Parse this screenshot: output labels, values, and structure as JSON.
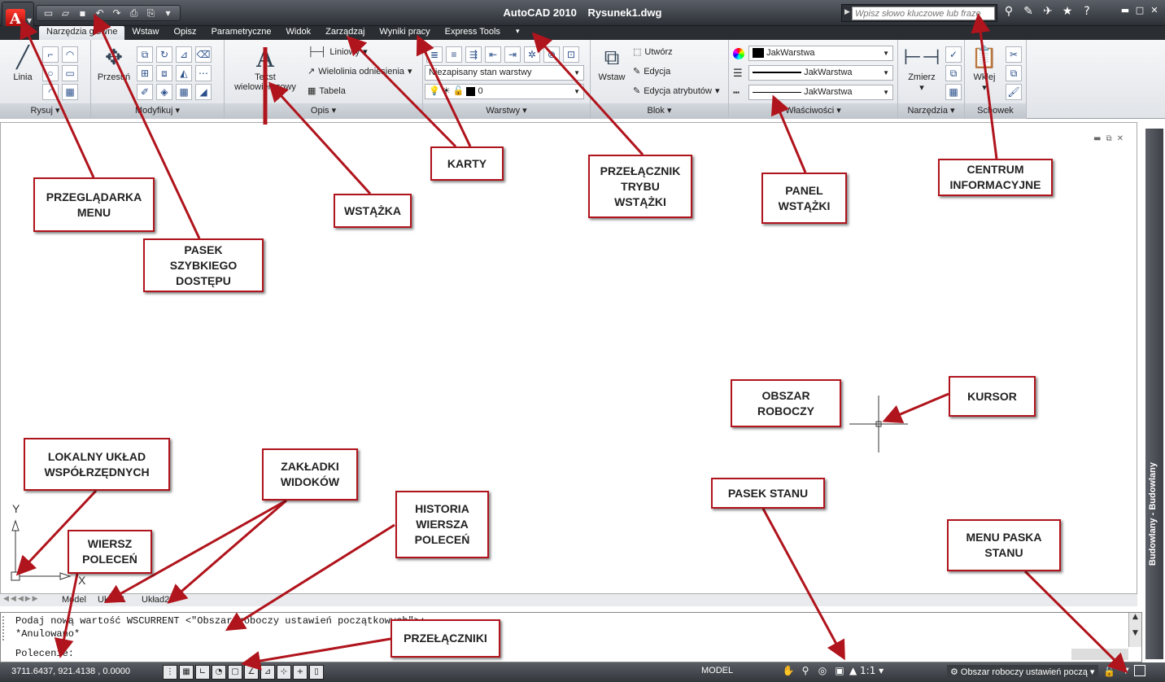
{
  "window": {
    "app_name": "AutoCAD 2010",
    "file_name": "Rysunek1.dwg"
  },
  "quick_access": [
    "new-icon",
    "open-icon",
    "save-icon",
    "undo-icon",
    "redo-icon",
    "plot-icon",
    "publish-icon"
  ],
  "infocenter": {
    "search_placeholder": "Wpisz słowo kluczowe lub frazę"
  },
  "tabs": [
    "Narzędzia główne",
    "Wstaw",
    "Opisz",
    "Parametryczne",
    "Widok",
    "Zarządzaj",
    "Wyniki pracy",
    "Express Tools"
  ],
  "ribbon": {
    "rysuj": {
      "title": "Rysuj",
      "linia": "Linia"
    },
    "modyfikuj": {
      "title": "Modyfikuj",
      "przesun": "Przesuń"
    },
    "opis": {
      "title": "Opis",
      "tekst": "Tekst",
      "tekst2": "wielowierszowy",
      "liniowy": "Liniowy",
      "wielolinia": "Wielolinia odniesienia",
      "tabela": "Tabela"
    },
    "warstwy": {
      "title": "Warstwy",
      "stan": "Niezapisany stan warstwy",
      "warstwa": "0"
    },
    "blok": {
      "title": "Blok",
      "wstaw": "Wstaw",
      "utworz": "Utwórz",
      "edycja": "Edycja",
      "edycja_atr": "Edycja atrybutów"
    },
    "wlasciwosci": {
      "title": "Właściwości",
      "kolor": "JakWarstwa",
      "rodzaj": "JakWarstwa",
      "grubosc": "JakWarstwa"
    },
    "narzedzia": {
      "title": "Narzędzia",
      "zmierz": "Zmierz"
    },
    "schowek": {
      "title": "Schowek",
      "wklej": "Wklej"
    }
  },
  "side_palette": "Budowlany - Budowlany",
  "layout_tabs": [
    "Model",
    "Układ1",
    "Układ2"
  ],
  "ucs": {
    "y": "Y",
    "x": "X"
  },
  "command_line": {
    "history": [
      "Podaj nową wartość WSCURRENT <\"Obszar roboczy ustawień początkowych\">:",
      "*Anulowano*"
    ],
    "prompt": "Polecenie:"
  },
  "status_bar": {
    "coordinates": "3711.6437, 921.4138 , 0.0000",
    "model": "MODEL",
    "scale": "1:1",
    "workspace": "Obszar roboczy ustawień począ"
  },
  "callouts": [
    {
      "id": "przegladarka",
      "text": "PRZEGLĄDARKA\nMENU"
    },
    {
      "id": "pasek-szybki",
      "text": "PASEK\nSZYBKIEGO\nDOSTĘPU"
    },
    {
      "id": "wstazka",
      "text": "WSTĄŻKA"
    },
    {
      "id": "karty",
      "text": "KARTY"
    },
    {
      "id": "przelacznik",
      "text": "PRZEŁĄCZNIK\nTRYBU\nWSTĄŻKI"
    },
    {
      "id": "panel",
      "text": "PANEL\nWSTĄŻKI"
    },
    {
      "id": "centrum",
      "text": "CENTRUM\nINFORMACYJNE"
    },
    {
      "id": "obszar",
      "text": "OBSZAR\nROBOCZY"
    },
    {
      "id": "kursor",
      "text": "KURSOR"
    },
    {
      "id": "lokalny",
      "text": "LOKALNY UKŁAD\nWSPÓŁRZĘDNYCH"
    },
    {
      "id": "zakladki",
      "text": "ZAKŁADKI\nWIDOKÓW"
    },
    {
      "id": "historia",
      "text": "HISTORIA\nWIERSZA\nPOLECEŃ"
    },
    {
      "id": "wiersz",
      "text": "WIERSZ\nPOLECEŃ"
    },
    {
      "id": "pasek-stanu",
      "text": "PASEK STANU"
    },
    {
      "id": "menu-paska",
      "text": "MENU PASKA\nSTANU"
    },
    {
      "id": "przelaczniki",
      "text": "PRZEŁĄCZNIKI"
    }
  ],
  "colors": {
    "annotation": "#b0141c",
    "title_bar": "#3c4047",
    "ribbon": "#e8eaed"
  }
}
